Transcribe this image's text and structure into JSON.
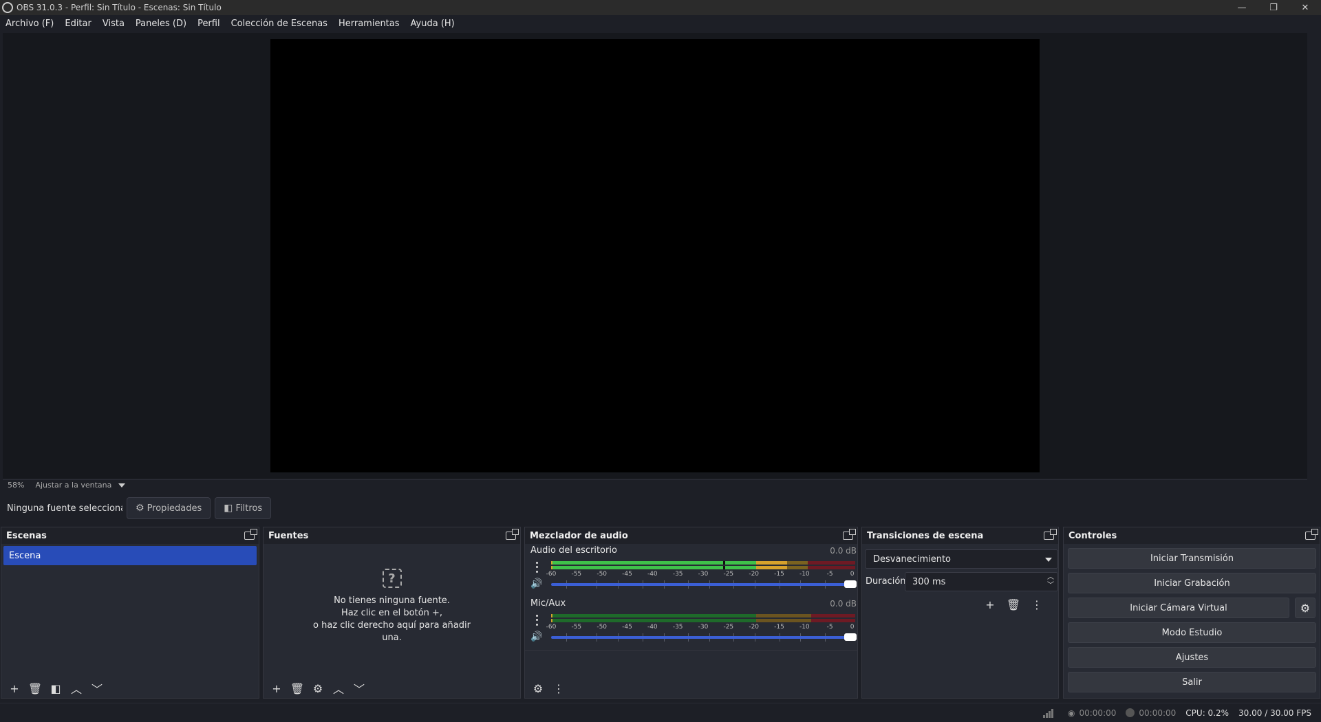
{
  "window": {
    "title": "OBS 31.0.3 - Perfil: Sin Título - Escenas: Sin Título",
    "controls": {
      "minimize": "—",
      "restore": "❐",
      "close": "✕"
    }
  },
  "menu": [
    "Archivo (F)",
    "Editar",
    "Vista",
    "Paneles (D)",
    "Perfil",
    "Colección de Escenas",
    "Herramientas",
    "Ayuda (H)"
  ],
  "preview": {
    "zoom": "58%",
    "fit_label": "Ajustar a la ventana"
  },
  "source_toolbar": {
    "no_source": "Ninguna fuente seleccionada",
    "properties": "Propiedades",
    "filters": "Filtros"
  },
  "scenes": {
    "title": "Escenas",
    "items": [
      "Escena"
    ]
  },
  "sources": {
    "title": "Fuentes",
    "empty_icon": "?",
    "empty_lines": [
      "No tienes ninguna fuente.",
      "Haz clic en el botón +,",
      "o haz clic derecho aquí para añadir",
      "una."
    ]
  },
  "mixer": {
    "title": "Mezclador de audio",
    "scale": [
      "-60",
      "-55",
      "-50",
      "-45",
      "-40",
      "-35",
      "-30",
      "-25",
      "-20",
      "-15",
      "-10",
      "-5",
      "0"
    ],
    "tracks": [
      {
        "name": "Audio del escritorio",
        "db": "0.0 dB",
        "volume": 1.0
      },
      {
        "name": "Mic/Aux",
        "db": "0.0 dB",
        "volume": 1.0
      }
    ]
  },
  "transitions": {
    "title": "Transiciones de escena",
    "selected": "Desvanecimiento",
    "duration_label": "Duración",
    "duration_value": "300 ms"
  },
  "controls": {
    "title": "Controles",
    "start_stream": "Iniciar Transmisión",
    "start_recording": "Iniciar Grabación",
    "start_virtual_cam": "Iniciar Cámara Virtual",
    "studio_mode": "Modo Estudio",
    "settings": "Ajustes",
    "exit": "Salir"
  },
  "status": {
    "stream_time": "00:00:00",
    "rec_time": "00:00:00",
    "cpu": "CPU: 0.2%",
    "fps": "30.00 / 30.00 FPS"
  },
  "colors": {
    "accent": "#284cb8",
    "slider": "#3b5fd6",
    "meter_green": "#3fc14a",
    "meter_yellow": "#d6a22c",
    "meter_red": "#b02030"
  }
}
